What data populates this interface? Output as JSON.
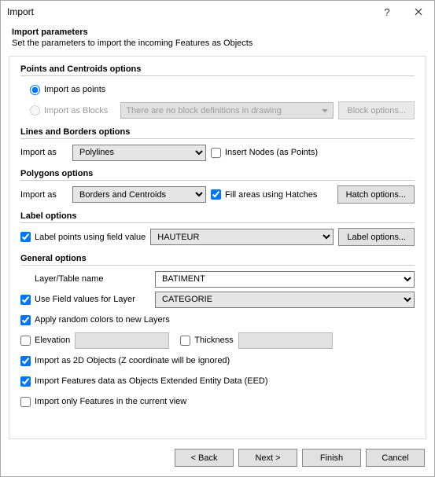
{
  "title": "Import",
  "header": {
    "h1": "Import parameters",
    "h2": "Set the parameters to import the incoming Features as Objects"
  },
  "points": {
    "title": "Points and Centroids options",
    "radio_points": "Import as points",
    "radio_blocks": "Import as Blocks",
    "no_blocks_msg": "There are no block definitions in drawing",
    "block_btn": "Block options..."
  },
  "lines": {
    "title": "Lines and Borders options",
    "import_as": "Import as",
    "value": "Polylines",
    "insert_nodes": "Insert Nodes (as Points)"
  },
  "polygons": {
    "title": "Polygons options",
    "import_as": "Import as",
    "value": "Borders and Centroids",
    "fill_label": "Fill areas using Hatches",
    "hatch_btn": "Hatch options..."
  },
  "label": {
    "title": "Label options",
    "use_label": "Label points using field value",
    "field": "HAUTEUR",
    "label_btn": "Label options..."
  },
  "general": {
    "title": "General options",
    "layer_name": "Layer/Table name",
    "layer_value": "BATIMENT",
    "use_field": "Use Field values for Layer",
    "field_value": "CATEGORIE",
    "random_colors": "Apply random colors to new Layers",
    "elevation": "Elevation",
    "thickness": "Thickness",
    "import_2d": "Import as 2D Objects (Z coordinate will be ignored)",
    "import_eed": "Import Features data as Objects Extended Entity Data (EED)",
    "import_view": "Import only Features in the current view"
  },
  "footer": {
    "back": "< Back",
    "next": "Next >",
    "finish": "Finish",
    "cancel": "Cancel"
  }
}
